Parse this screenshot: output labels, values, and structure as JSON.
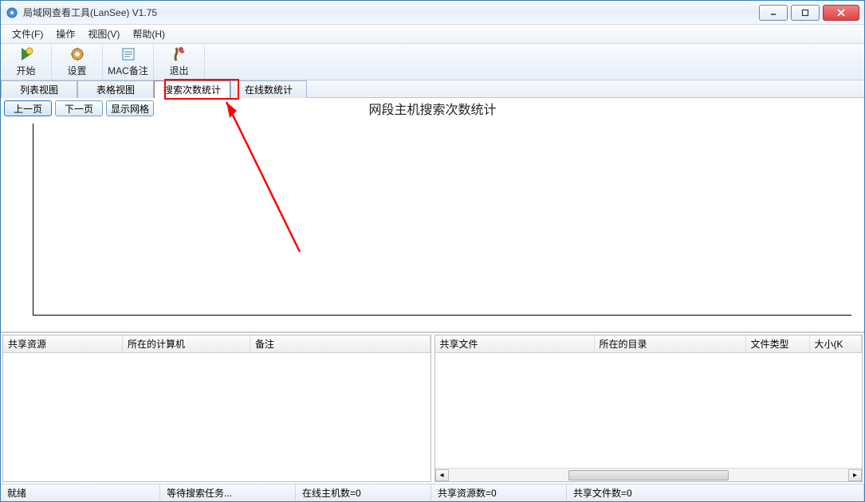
{
  "window": {
    "title": "局域网查看工具(LanSee) V1.75"
  },
  "menus": {
    "file": "文件(F)",
    "operate": "操作",
    "view": "视图(V)",
    "help": "帮助(H)"
  },
  "toolbar": {
    "start": "开始",
    "settings": "设置",
    "mac_note": "MAC备注",
    "exit": "退出"
  },
  "tabs": {
    "list_view": "列表视图",
    "table_view": "表格视图",
    "search_stats": "搜索次数统计",
    "online_stats": "在线数统计"
  },
  "nav": {
    "prev": "上一页",
    "next": "下一页",
    "show_grid": "显示网格"
  },
  "chart": {
    "title": "网段主机搜索次数统计"
  },
  "left_panel": {
    "cols": {
      "shared_resource": "共享资源",
      "host_computer": "所在的计算机",
      "remark": "备注"
    }
  },
  "right_panel": {
    "cols": {
      "shared_file": "共享文件",
      "directory": "所在的目录",
      "file_type": "文件类型",
      "size": "大小(K"
    }
  },
  "status": {
    "ready": "就绪",
    "waiting": "等待搜索任务...",
    "online_hosts": "在线主机数=0",
    "shared_resources": "共享资源数=0",
    "shared_files": "共享文件数=0"
  }
}
